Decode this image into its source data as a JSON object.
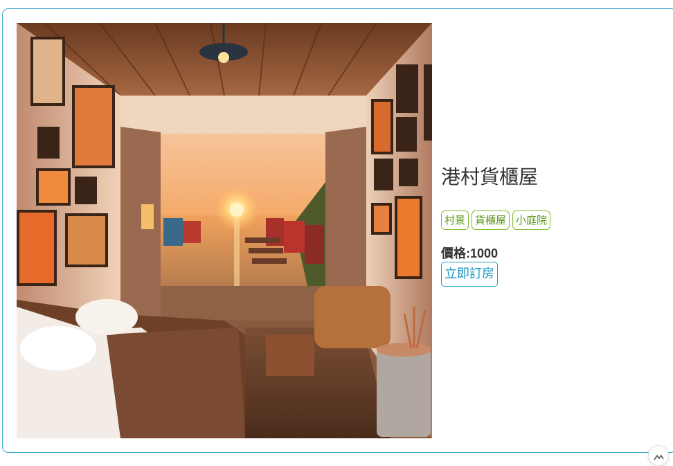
{
  "room": {
    "title": "港村貨櫃屋",
    "tags": [
      "村景",
      "貨櫃屋",
      "小庭院"
    ],
    "price_label": "價格:",
    "price_value": "1000",
    "book_button": "立即訂房",
    "image": {
      "subject": "container-house-bedroom-sunset-harbor-view"
    }
  },
  "colors": {
    "card_border": "#3aaed0",
    "tag_border": "#7fbb2a",
    "tag_text": "#5e9518",
    "button_border": "#17a2c8",
    "button_text": "#1296bf"
  },
  "scroll_top": {
    "icon": "chevron-up-icon"
  }
}
